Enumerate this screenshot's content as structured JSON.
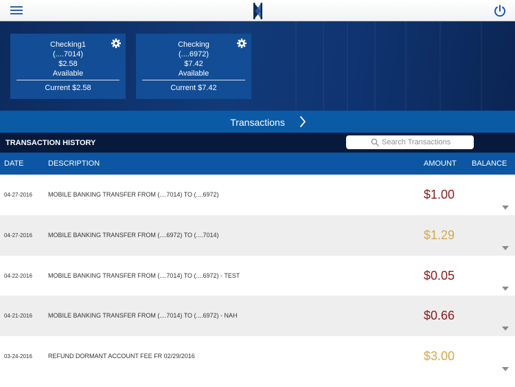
{
  "accounts": [
    {
      "name": "Checking1",
      "number": "(....7014)",
      "available_amount": "$2.58",
      "available_label": "Available",
      "current": "Current $2.58"
    },
    {
      "name": "Checking",
      "number": "(....6972)",
      "available_amount": "$7.42",
      "available_label": "Available",
      "current": "Current $7.42"
    }
  ],
  "transactions_bar": {
    "label": "Transactions"
  },
  "history": {
    "title": "TRANSACTION HISTORY",
    "search_placeholder": "Search Transactions"
  },
  "columns": {
    "date": "DATE",
    "description": "DESCRIPTION",
    "amount": "AMOUNT",
    "balance": "BALANCE"
  },
  "colors": {
    "debit": "#8b1a1a",
    "credit": "#d4a848",
    "brand_blue": "#0d56a3",
    "navy": "#071a3c"
  },
  "transactions": [
    {
      "date": "04-27-2016",
      "description": "MOBILE BANKING TRANSFER FROM (....7014) TO (....6972)",
      "amount": "$1.00",
      "type": "debit"
    },
    {
      "date": "04-27-2016",
      "description": "MOBILE BANKING TRANSFER FROM (....6972) TO (....7014)",
      "amount": "$1.29",
      "type": "credit"
    },
    {
      "date": "04-22-2016",
      "description": "MOBILE BANKING TRANSFER FROM (....7014) TO (....6972) - TEST",
      "amount": "$0.05",
      "type": "debit"
    },
    {
      "date": "04-21-2016",
      "description": "MOBILE BANKING TRANSFER FROM (....7014) TO (....6972) - NAH",
      "amount": "$0.66",
      "type": "debit"
    },
    {
      "date": "03-24-2016",
      "description": "REFUND DORMANT ACCOUNT FEE FR 02/29/2016",
      "amount": "$3.00",
      "type": "credit"
    }
  ]
}
